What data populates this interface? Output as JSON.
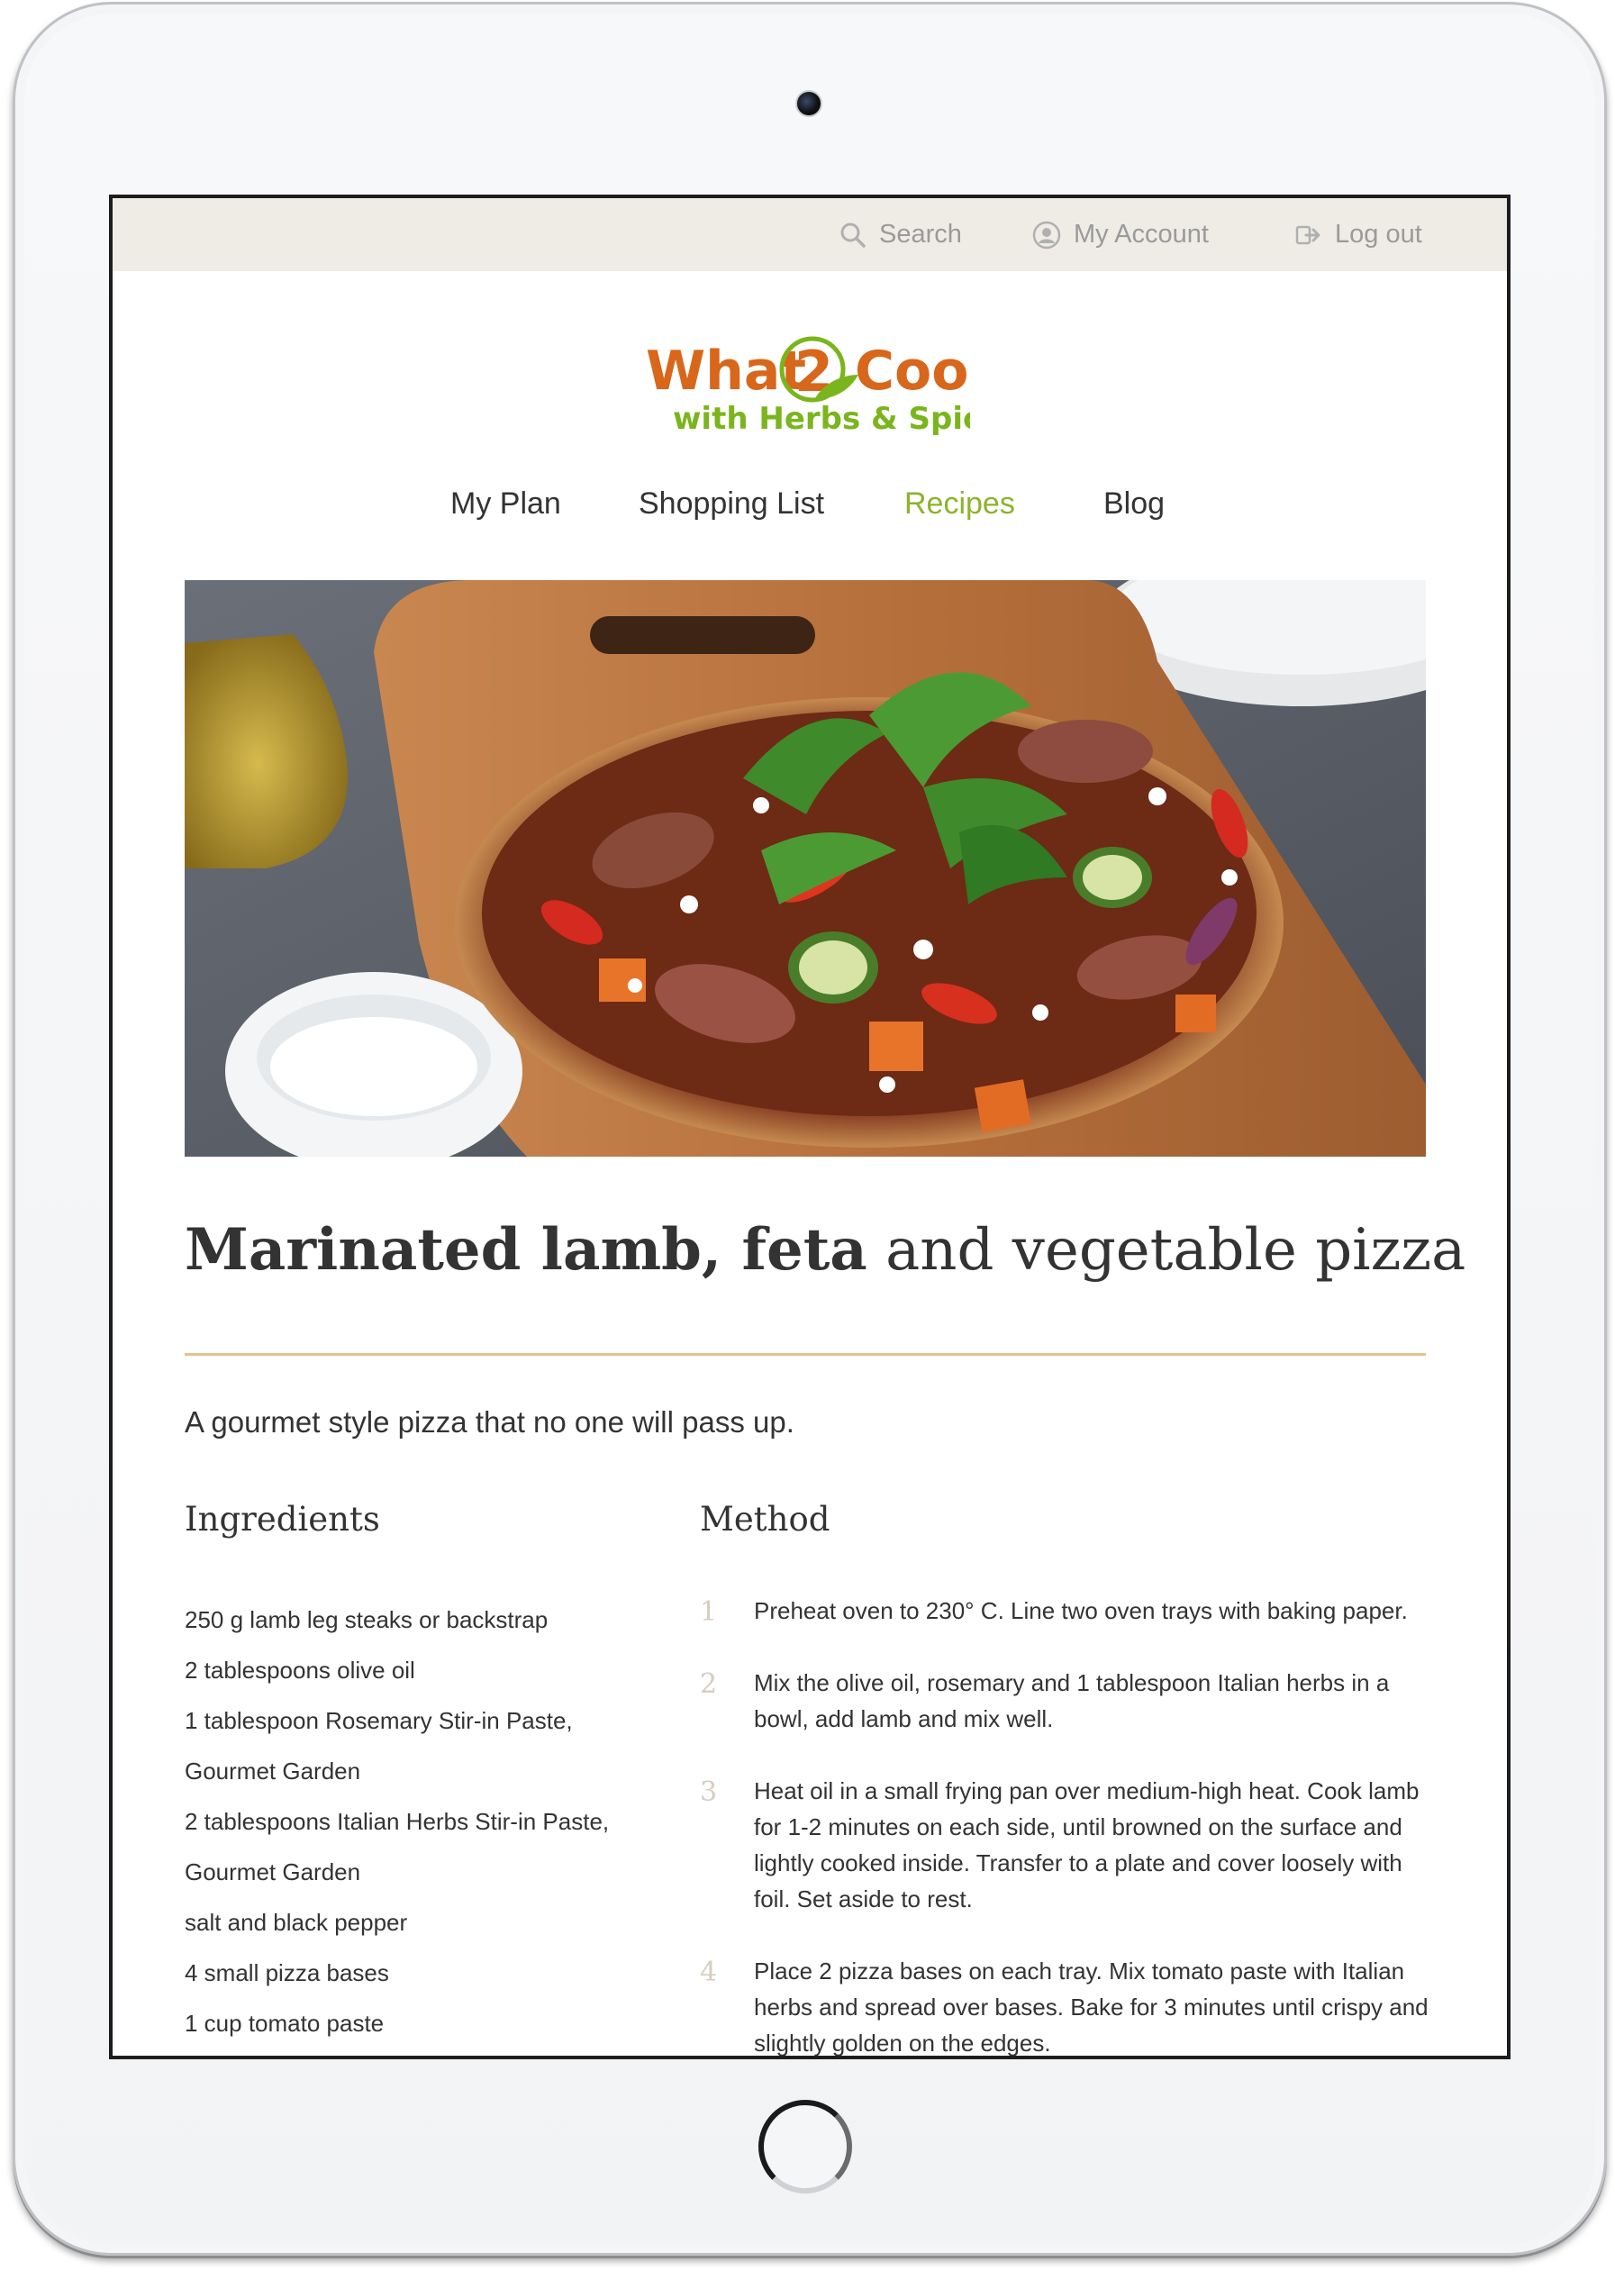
{
  "topbar": {
    "search_label": "Search",
    "account_label": "My Account",
    "logout_label": "Log out"
  },
  "logo": {
    "line1_left": "What",
    "line1_numeral": "2",
    "line1_right": "Cook",
    "line2": "with Herbs & Spices"
  },
  "nav": {
    "items": [
      "My Plan",
      "Shopping List",
      "Recipes",
      "Blog"
    ],
    "active": "Recipes"
  },
  "recipe": {
    "title_strong": "Marinated lamb, feta",
    "title_light": "and vegetable pizza",
    "tagline": "A gourmet style pizza that no one will pass up.",
    "ingredients_heading": "Ingredients",
    "method_heading": "Method",
    "ingredients": [
      "250 g lamb leg steaks or backstrap",
      "2 tablespoons olive oil",
      "1 tablespoon Rosemary Stir-in Paste,",
      "Gourmet Garden",
      "2 tablespoons Italian Herbs Stir-in Paste,",
      "Gourmet Garden",
      "salt and black pepper",
      "4 small pizza bases",
      "1 cup tomato paste"
    ],
    "method": [
      {
        "num": "1",
        "text": "Preheat oven to 230° C. Line two oven trays with baking paper."
      },
      {
        "num": "2",
        "text": "Mix the olive oil, rosemary and 1 tablespoon Italian herbs in a bowl, add lamb and mix well."
      },
      {
        "num": "3",
        "text": "Heat oil in a small frying pan over medium-high heat. Cook lamb for 1-2 minutes on each side, until browned on the surface and lightly cooked inside. Transfer to a plate and cover loosely with foil. Set aside to rest."
      },
      {
        "num": "4",
        "text": "Place 2 pizza bases on each tray. Mix tomato paste with Italian herbs and spread over bases. Bake for 3 minutes until crispy and slightly golden on the edges."
      }
    ]
  },
  "colors": {
    "accent_green": "#8cb32c",
    "logo_orange": "#d8661b",
    "logo_green": "#7ab51d",
    "rule_gold": "#e4c48a",
    "topbar_bg": "#efece6"
  }
}
